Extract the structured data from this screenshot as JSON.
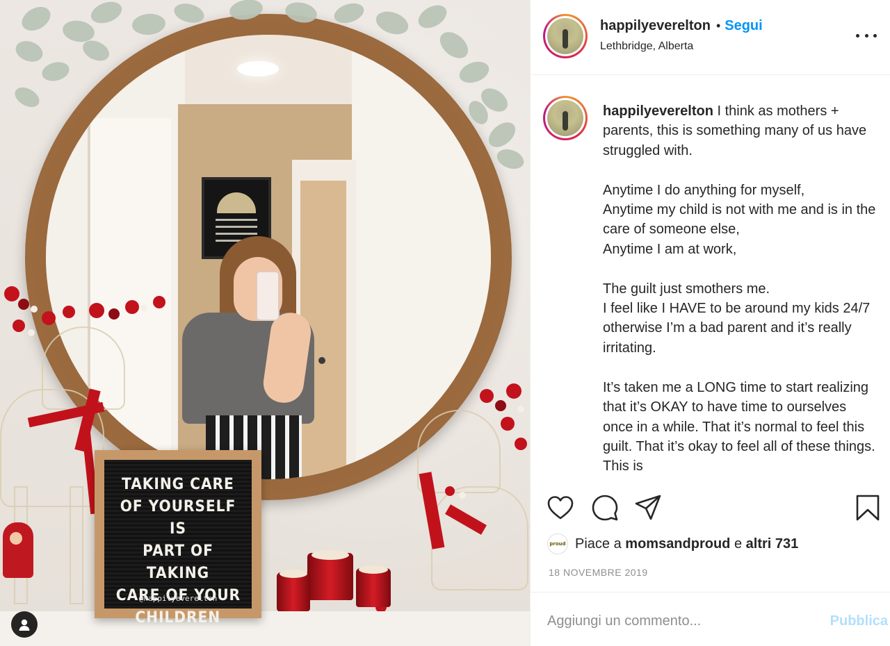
{
  "post": {
    "author": "happilyeverelton",
    "follow_label": "Segui",
    "separator": "•",
    "location": "Lethbridge, Alberta",
    "caption": " I think as mothers + parents, this is something many of us have struggled with.\n\nAnytime I do anything for myself,\nAnytime my child is not with me and is in the care of someone else,\nAnytime I am at work,\n\nThe guilt just smothers me.\nI feel like I HAVE to be around my kids 24/7 otherwise I’m a bad parent and it’s really irritating.\n\nIt’s taken me a LONG time to start realizing that it’s OKAY to have time to ourselves once in a while. That it’s normal to feel this guilt. That it’s okay to feel all of these things. This is",
    "likes": {
      "prefix": "Piace a",
      "liked_by": "momsandproud",
      "conjunction": "e",
      "others": "altri 731",
      "avatar_text": "proud"
    },
    "date": "18 NOVEMBRE 2019"
  },
  "photo": {
    "letterboard_lines": [
      "TAKING CARE",
      "OF YOURSELF IS",
      "PART OF TAKING",
      "CARE OF YOUR",
      "CHILDREN"
    ],
    "letterboard_handle": "@happilyeverelton"
  },
  "comment": {
    "placeholder": "Aggiungi un commento...",
    "publish_label": "Pubblica"
  },
  "icons": {
    "like": "heart-icon",
    "comment": "comment-icon",
    "share": "paper-plane-icon",
    "save": "bookmark-icon",
    "more": "more-icon",
    "user_tags": "user-icon"
  },
  "colors": {
    "accent": "#0095f6",
    "publish_disabled": "#b2dffc",
    "text": "#262626",
    "muted": "#8e8e8e"
  }
}
